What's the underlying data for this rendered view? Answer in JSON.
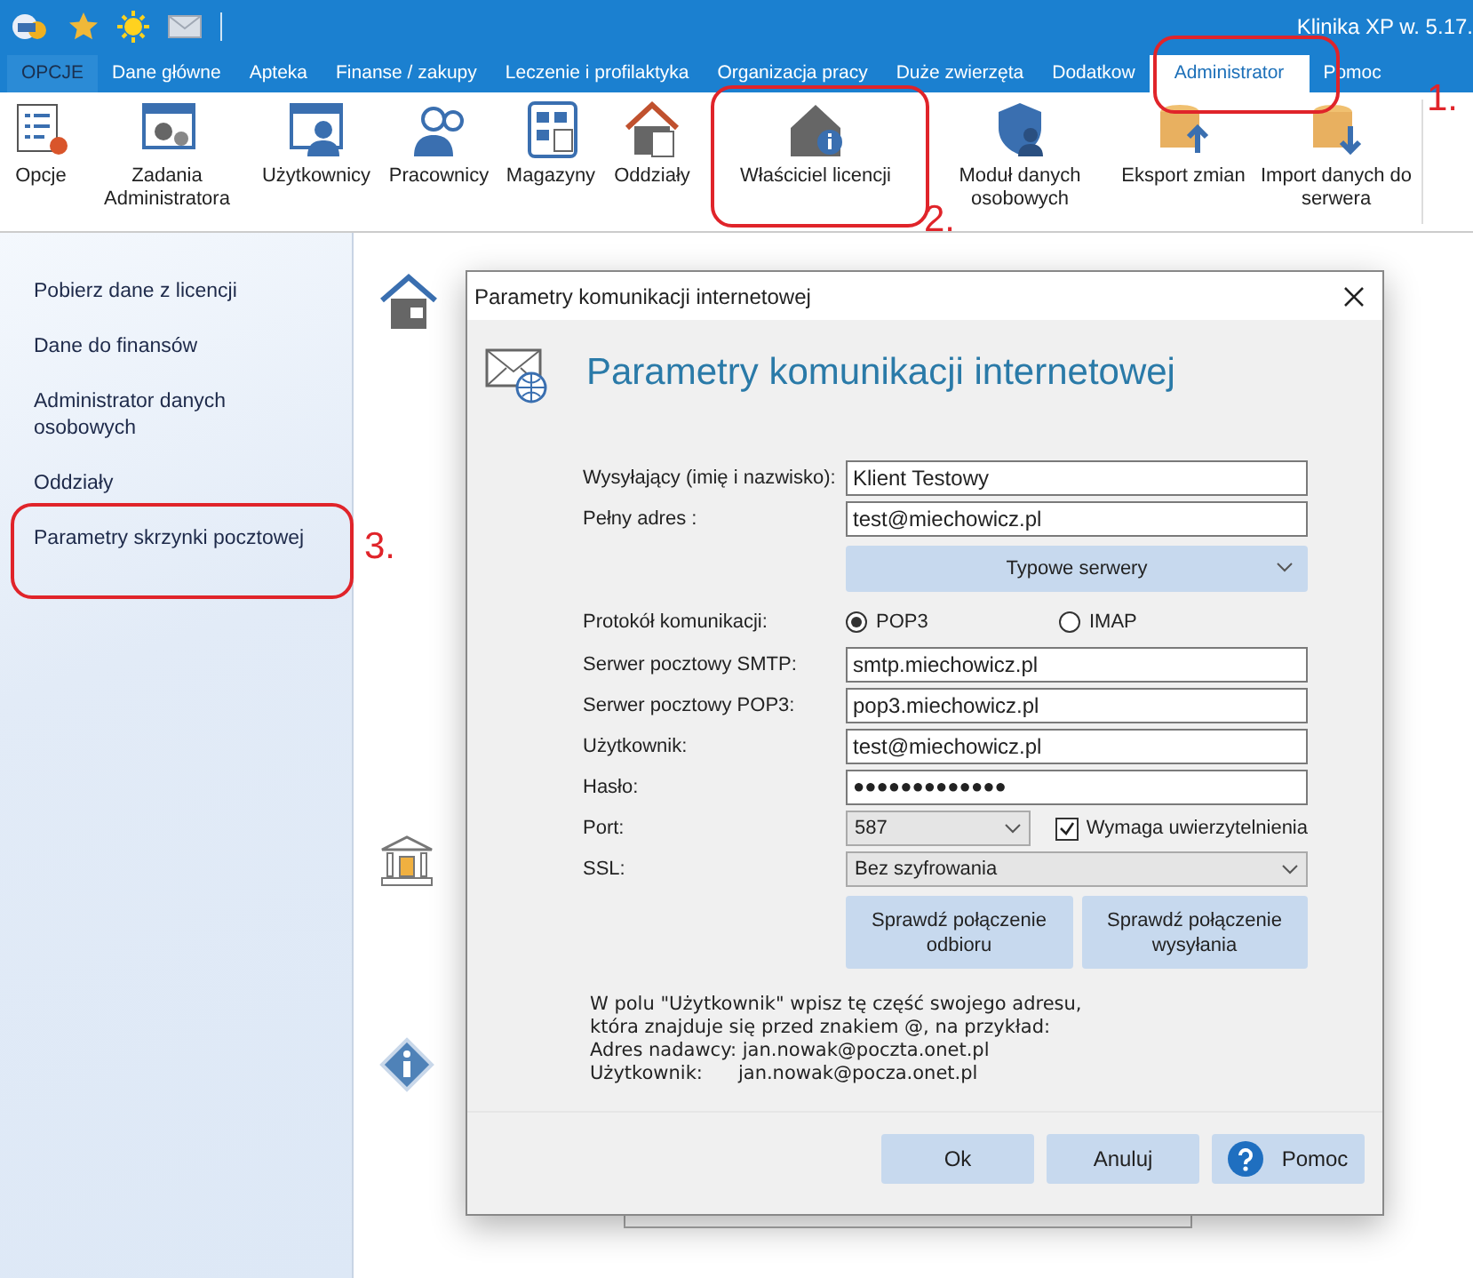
{
  "window": {
    "title": "Klinika XP w. 5.17."
  },
  "tabs": [
    {
      "label": "OPCJE",
      "kind": "app",
      "selected": false
    },
    {
      "label": "Dane główne",
      "kind": "tab",
      "selected": false
    },
    {
      "label": "Apteka",
      "kind": "tab",
      "selected": false
    },
    {
      "label": "Finanse / zakupy",
      "kind": "tab",
      "selected": false
    },
    {
      "label": "Leczenie i profilaktyka",
      "kind": "tab",
      "selected": false
    },
    {
      "label": "Organizacja pracy",
      "kind": "tab",
      "selected": false
    },
    {
      "label": "Duże zwierzęta",
      "kind": "tab",
      "selected": false
    },
    {
      "label": "Dodatkow",
      "kind": "tab",
      "selected": false
    },
    {
      "label": "Administrator",
      "kind": "tab",
      "selected": true
    },
    {
      "label": "Pomoc",
      "kind": "tab",
      "selected": false
    }
  ],
  "ribbon": [
    {
      "label": "Opcje",
      "kind": "options"
    },
    {
      "label": "Zadania Administratora",
      "kind": "tasks"
    },
    {
      "label": "Użytkownicy",
      "kind": "users"
    },
    {
      "label": "Pracownicy",
      "kind": "staff"
    },
    {
      "label": "Magazyny",
      "kind": "stores"
    },
    {
      "label": "Oddziały",
      "kind": "branches"
    },
    {
      "label": "Właściciel licencji",
      "kind": "owner"
    },
    {
      "label": "Moduł danych osobowych",
      "kind": "shield"
    },
    {
      "label": "Eksport zmian",
      "kind": "export"
    },
    {
      "label": "Import danych do serwera",
      "kind": "import"
    }
  ],
  "sidebar": {
    "items": [
      {
        "label": "Pobierz dane z licencji"
      },
      {
        "label": "Dane do finansów"
      },
      {
        "label": "Administrator danych osobowych"
      },
      {
        "label": "Oddziały"
      },
      {
        "label": "Parametry skrzynki pocztowej"
      }
    ]
  },
  "dialog": {
    "title": "Parametry komunikacji internetowej",
    "heading": "Parametry komunikacji internetowej",
    "rows": [
      {
        "kind": "text",
        "label": "Wysyłający (imię i nazwisko):",
        "value": "Klient Testowy"
      },
      {
        "kind": "text",
        "label": "Pełny adres :",
        "value": "test@miechowicz.pl"
      },
      {
        "kind": "dropdown_button",
        "value": "Typowe serwery"
      },
      {
        "kind": "radio",
        "label": "Protokół komunikacji:",
        "options": [
          {
            "label": "POP3",
            "selected": true
          },
          {
            "label": "IMAP",
            "selected": false
          }
        ]
      },
      {
        "kind": "text",
        "label": "Serwer pocztowy SMTP:",
        "value": "smtp.miechowicz.pl"
      },
      {
        "kind": "text",
        "label": "Serwer pocztowy POP3:",
        "value": "pop3.miechowicz.pl"
      },
      {
        "kind": "text",
        "label": "Użytkownik:",
        "value": "test@miechowicz.pl"
      },
      {
        "kind": "password",
        "label": "Hasło:",
        "value": "●●●●●●●●●●●●●"
      },
      {
        "kind": "select",
        "label": "Port:",
        "value": "587",
        "checkbox": {
          "label": "Wymaga uwierzytelnienia",
          "checked": true
        }
      },
      {
        "kind": "select",
        "label": "SSL:",
        "value": "Bez szyfrowania"
      },
      {
        "kind": "buttons",
        "buttons": [
          "Sprawdź połączenie odbioru",
          "Sprawdź połączenie wysyłania"
        ]
      }
    ],
    "note": "W polu \"Użytkownik\" wpisz tę część swojego adresu,\nktóra znajduje się przed znakiem @, na przykład:\nAdres nadawcy: jan.nowak@poczta.onet.pl\nUżytkownik:      jan.nowak@pocza.onet.pl",
    "footer_buttons": [
      {
        "label": "Ok",
        "kind": "plain"
      },
      {
        "label": "Anuluj",
        "kind": "plain"
      },
      {
        "label": "Pomoc",
        "kind": "help"
      }
    ]
  },
  "annotations": [
    {
      "label": "1."
    },
    {
      "label": "2."
    },
    {
      "label": "3."
    }
  ]
}
